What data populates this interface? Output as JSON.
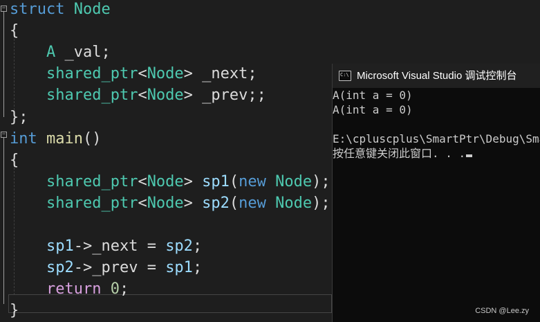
{
  "editor": {
    "lines": [
      [
        {
          "t": "struct",
          "c": "kw"
        },
        {
          "t": " ",
          "c": "plain"
        },
        {
          "t": "Node",
          "c": "ty"
        }
      ],
      [
        {
          "t": "{",
          "c": "plain"
        }
      ],
      [
        {
          "t": "    ",
          "c": "plain"
        },
        {
          "t": "A",
          "c": "ty"
        },
        {
          "t": " _val;",
          "c": "plain"
        }
      ],
      [
        {
          "t": "    ",
          "c": "plain"
        },
        {
          "t": "shared_ptr",
          "c": "ty"
        },
        {
          "t": "<",
          "c": "plain"
        },
        {
          "t": "Node",
          "c": "ty"
        },
        {
          "t": "> _next;",
          "c": "plain"
        }
      ],
      [
        {
          "t": "    ",
          "c": "plain"
        },
        {
          "t": "shared_ptr",
          "c": "ty"
        },
        {
          "t": "<",
          "c": "plain"
        },
        {
          "t": "Node",
          "c": "ty"
        },
        {
          "t": "> _prev;;",
          "c": "plain"
        }
      ],
      [
        {
          "t": "};",
          "c": "plain"
        }
      ],
      [
        {
          "t": "int",
          "c": "kw"
        },
        {
          "t": " ",
          "c": "plain"
        },
        {
          "t": "main",
          "c": "fn"
        },
        {
          "t": "()",
          "c": "plain"
        }
      ],
      [
        {
          "t": "{",
          "c": "plain"
        }
      ],
      [
        {
          "t": "    ",
          "c": "plain"
        },
        {
          "t": "shared_ptr",
          "c": "ty"
        },
        {
          "t": "<",
          "c": "plain"
        },
        {
          "t": "Node",
          "c": "ty"
        },
        {
          "t": "> ",
          "c": "plain"
        },
        {
          "t": "sp1",
          "c": "var"
        },
        {
          "t": "(",
          "c": "plain"
        },
        {
          "t": "new",
          "c": "kw"
        },
        {
          "t": " ",
          "c": "plain"
        },
        {
          "t": "Node",
          "c": "ty"
        },
        {
          "t": ");",
          "c": "plain"
        }
      ],
      [
        {
          "t": "    ",
          "c": "plain"
        },
        {
          "t": "shared_ptr",
          "c": "ty"
        },
        {
          "t": "<",
          "c": "plain"
        },
        {
          "t": "Node",
          "c": "ty"
        },
        {
          "t": "> ",
          "c": "plain"
        },
        {
          "t": "sp2",
          "c": "var"
        },
        {
          "t": "(",
          "c": "plain"
        },
        {
          "t": "new",
          "c": "kw"
        },
        {
          "t": " ",
          "c": "plain"
        },
        {
          "t": "Node",
          "c": "ty"
        },
        {
          "t": ");",
          "c": "plain"
        }
      ],
      [],
      [
        {
          "t": "    ",
          "c": "plain"
        },
        {
          "t": "sp1",
          "c": "var"
        },
        {
          "t": "->_next = ",
          "c": "plain"
        },
        {
          "t": "sp2",
          "c": "var"
        },
        {
          "t": ";",
          "c": "plain"
        }
      ],
      [
        {
          "t": "    ",
          "c": "plain"
        },
        {
          "t": "sp2",
          "c": "var"
        },
        {
          "t": "->_prev = ",
          "c": "plain"
        },
        {
          "t": "sp1",
          "c": "var"
        },
        {
          "t": ";",
          "c": "plain"
        }
      ],
      [
        {
          "t": "    ",
          "c": "plain"
        },
        {
          "t": "return",
          "c": "ctl"
        },
        {
          "t": " ",
          "c": "plain"
        },
        {
          "t": "0",
          "c": "num"
        },
        {
          "t": ";",
          "c": "plain"
        }
      ],
      [
        {
          "t": "}",
          "c": "plain"
        }
      ]
    ],
    "colors": {
      "background": "#1e1e1e",
      "keyword": "#569cd6",
      "type": "#4ec9b0",
      "function": "#dcdcaa",
      "variable": "#9cdcfe",
      "control": "#d8a0df",
      "number": "#b5cea8",
      "text": "#dcdcdc"
    }
  },
  "console": {
    "icon": "console-app-icon",
    "title": "Microsoft Visual Studio 调试控制台",
    "lines": [
      "A(int a = 0)",
      "A(int a = 0)",
      "",
      "E:\\cpluscplus\\SmartPtr\\Debug\\SmartPtr.exe",
      "按任意键关闭此窗口. . ."
    ],
    "colors": {
      "background": "#0c0c0c",
      "titlebar": "#202020",
      "text": "#cccccc"
    }
  },
  "watermark": "CSDN @Lee.zy"
}
